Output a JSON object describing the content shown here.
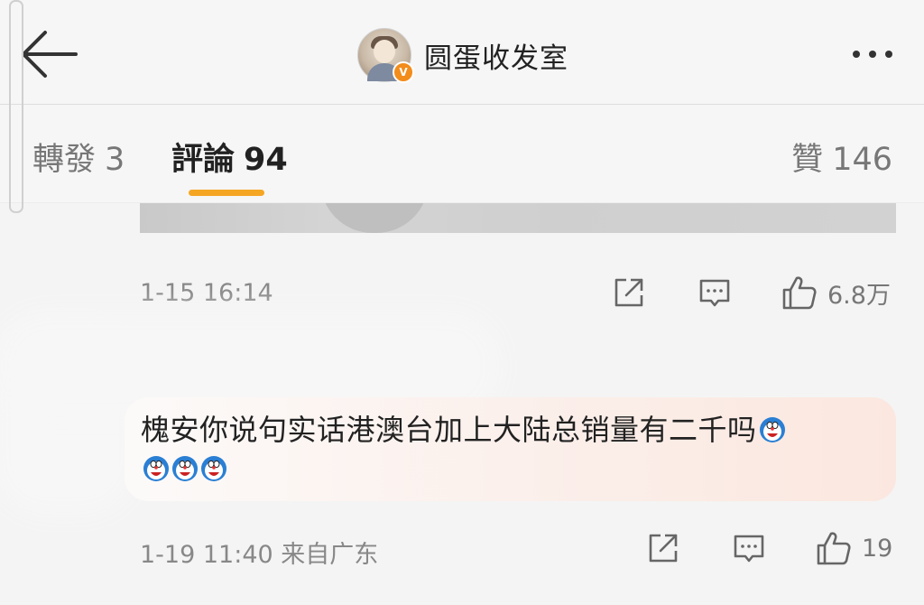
{
  "header": {
    "back_icon": "arrow-left-icon",
    "title": "圆蛋收发室",
    "verified_badge": "V",
    "more_icon": "more-dots-icon"
  },
  "tabs": [
    {
      "label": "轉發",
      "count": "3",
      "active": false
    },
    {
      "label": "評論",
      "count": "94",
      "active": true
    },
    {
      "label": "贊",
      "count": "146",
      "active": false
    }
  ],
  "colors": {
    "accent": "#f5a623",
    "verified": "#f28c1b",
    "bubble_start": "#fcfaf9",
    "bubble_end": "#fbe7df"
  },
  "post": {
    "time": "1-15 16:14",
    "like_count": "6.8万"
  },
  "comment": {
    "text": "槐安你说句实话港澳台加上大陆总销量有二千吗",
    "emoji_icon": "doraemon-emoji-icon",
    "time": "1-19 11:40 来自广东",
    "like_count": "19"
  },
  "icons": {
    "share": "share-icon",
    "comment": "comment-icon",
    "like": "thumbs-up-icon"
  }
}
